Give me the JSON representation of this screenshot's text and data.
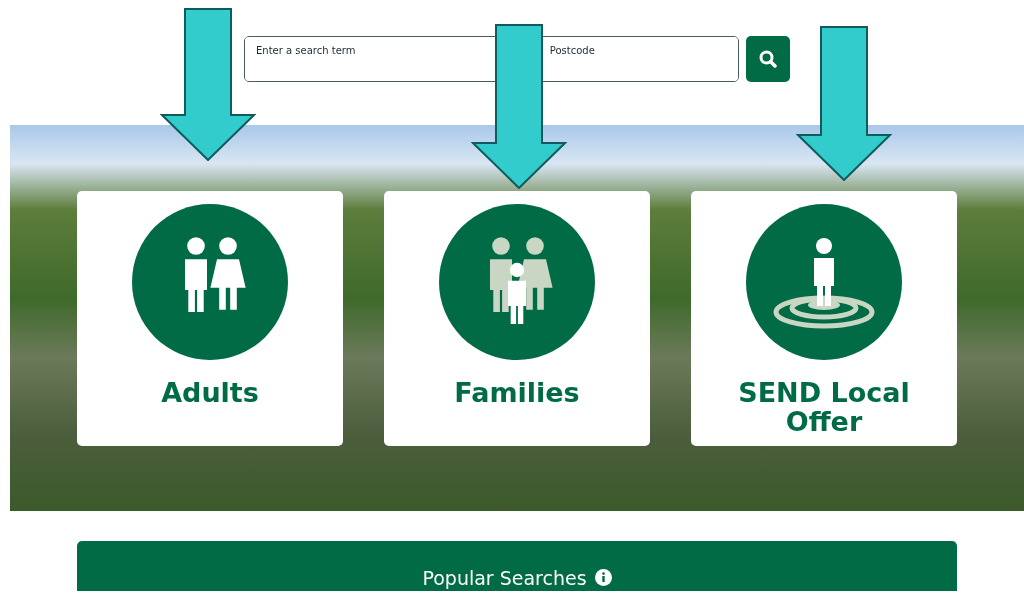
{
  "search": {
    "term_placeholder": "Enter a search term",
    "postcode_placeholder": "Postcode"
  },
  "cards": [
    {
      "kind": "adults",
      "label": "Adults"
    },
    {
      "kind": "families",
      "label": "Families"
    },
    {
      "kind": "send",
      "label": "SEND Local Offer"
    }
  ],
  "popular_searches": {
    "title": "Popular Searches"
  }
}
